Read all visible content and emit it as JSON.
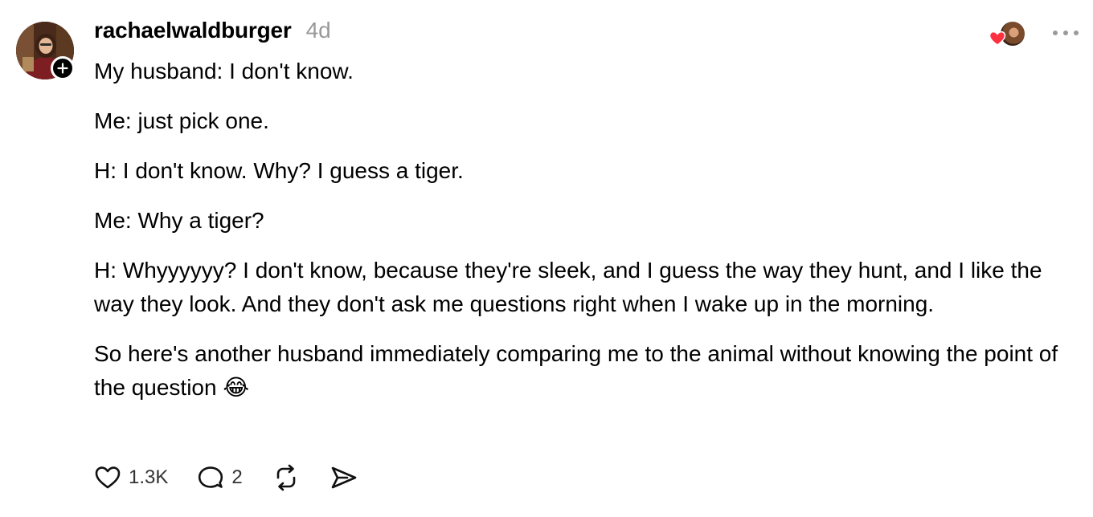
{
  "post": {
    "author": {
      "username": "rachaelwaldburger",
      "timestamp": "4d",
      "avatar_icon": "profile-photo",
      "follow_icon": "plus-icon"
    },
    "body": {
      "paragraphs": [
        "My husband: I don't know.",
        "Me: just pick one.",
        "H: I don't know. Why? I guess a tiger.",
        "Me: Why a tiger?",
        "H: Whyyyyyy? I don't know, because they're sleek, and I guess the way they hunt, and I like the way they look. And they don't ask me questions right when I wake up in the morning.",
        "So here's another husband immediately comparing me to the animal without knowing the point of the question 😂"
      ]
    },
    "likers": {
      "heart_color": "#ff3040",
      "icon": "heart-icon"
    },
    "actions": {
      "like_count": "1.3K",
      "reply_count": "2",
      "like_icon": "heart-outline-icon",
      "reply_icon": "speech-bubble-icon",
      "repost_icon": "repost-icon",
      "share_icon": "send-icon",
      "more_icon": "ellipsis-icon"
    }
  }
}
